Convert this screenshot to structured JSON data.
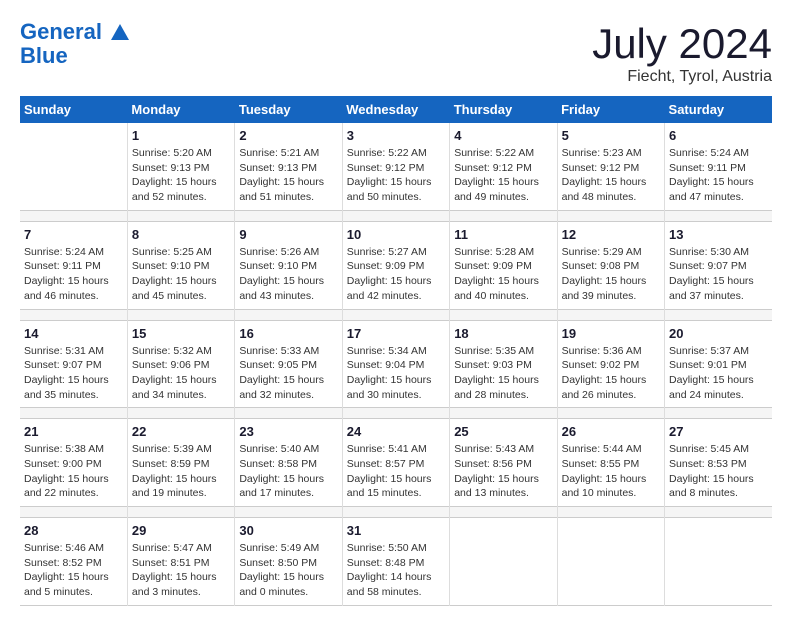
{
  "header": {
    "logo_line1": "General",
    "logo_line2": "Blue",
    "month_year": "July 2024",
    "location": "Fiecht, Tyrol, Austria"
  },
  "weekdays": [
    "Sunday",
    "Monday",
    "Tuesday",
    "Wednesday",
    "Thursday",
    "Friday",
    "Saturday"
  ],
  "weeks": [
    [
      {
        "day": "",
        "info": ""
      },
      {
        "day": "1",
        "info": "Sunrise: 5:20 AM\nSunset: 9:13 PM\nDaylight: 15 hours\nand 52 minutes."
      },
      {
        "day": "2",
        "info": "Sunrise: 5:21 AM\nSunset: 9:13 PM\nDaylight: 15 hours\nand 51 minutes."
      },
      {
        "day": "3",
        "info": "Sunrise: 5:22 AM\nSunset: 9:12 PM\nDaylight: 15 hours\nand 50 minutes."
      },
      {
        "day": "4",
        "info": "Sunrise: 5:22 AM\nSunset: 9:12 PM\nDaylight: 15 hours\nand 49 minutes."
      },
      {
        "day": "5",
        "info": "Sunrise: 5:23 AM\nSunset: 9:12 PM\nDaylight: 15 hours\nand 48 minutes."
      },
      {
        "day": "6",
        "info": "Sunrise: 5:24 AM\nSunset: 9:11 PM\nDaylight: 15 hours\nand 47 minutes."
      }
    ],
    [
      {
        "day": "7",
        "info": "Sunrise: 5:24 AM\nSunset: 9:11 PM\nDaylight: 15 hours\nand 46 minutes."
      },
      {
        "day": "8",
        "info": "Sunrise: 5:25 AM\nSunset: 9:10 PM\nDaylight: 15 hours\nand 45 minutes."
      },
      {
        "day": "9",
        "info": "Sunrise: 5:26 AM\nSunset: 9:10 PM\nDaylight: 15 hours\nand 43 minutes."
      },
      {
        "day": "10",
        "info": "Sunrise: 5:27 AM\nSunset: 9:09 PM\nDaylight: 15 hours\nand 42 minutes."
      },
      {
        "day": "11",
        "info": "Sunrise: 5:28 AM\nSunset: 9:09 PM\nDaylight: 15 hours\nand 40 minutes."
      },
      {
        "day": "12",
        "info": "Sunrise: 5:29 AM\nSunset: 9:08 PM\nDaylight: 15 hours\nand 39 minutes."
      },
      {
        "day": "13",
        "info": "Sunrise: 5:30 AM\nSunset: 9:07 PM\nDaylight: 15 hours\nand 37 minutes."
      }
    ],
    [
      {
        "day": "14",
        "info": "Sunrise: 5:31 AM\nSunset: 9:07 PM\nDaylight: 15 hours\nand 35 minutes."
      },
      {
        "day": "15",
        "info": "Sunrise: 5:32 AM\nSunset: 9:06 PM\nDaylight: 15 hours\nand 34 minutes."
      },
      {
        "day": "16",
        "info": "Sunrise: 5:33 AM\nSunset: 9:05 PM\nDaylight: 15 hours\nand 32 minutes."
      },
      {
        "day": "17",
        "info": "Sunrise: 5:34 AM\nSunset: 9:04 PM\nDaylight: 15 hours\nand 30 minutes."
      },
      {
        "day": "18",
        "info": "Sunrise: 5:35 AM\nSunset: 9:03 PM\nDaylight: 15 hours\nand 28 minutes."
      },
      {
        "day": "19",
        "info": "Sunrise: 5:36 AM\nSunset: 9:02 PM\nDaylight: 15 hours\nand 26 minutes."
      },
      {
        "day": "20",
        "info": "Sunrise: 5:37 AM\nSunset: 9:01 PM\nDaylight: 15 hours\nand 24 minutes."
      }
    ],
    [
      {
        "day": "21",
        "info": "Sunrise: 5:38 AM\nSunset: 9:00 PM\nDaylight: 15 hours\nand 22 minutes."
      },
      {
        "day": "22",
        "info": "Sunrise: 5:39 AM\nSunset: 8:59 PM\nDaylight: 15 hours\nand 19 minutes."
      },
      {
        "day": "23",
        "info": "Sunrise: 5:40 AM\nSunset: 8:58 PM\nDaylight: 15 hours\nand 17 minutes."
      },
      {
        "day": "24",
        "info": "Sunrise: 5:41 AM\nSunset: 8:57 PM\nDaylight: 15 hours\nand 15 minutes."
      },
      {
        "day": "25",
        "info": "Sunrise: 5:43 AM\nSunset: 8:56 PM\nDaylight: 15 hours\nand 13 minutes."
      },
      {
        "day": "26",
        "info": "Sunrise: 5:44 AM\nSunset: 8:55 PM\nDaylight: 15 hours\nand 10 minutes."
      },
      {
        "day": "27",
        "info": "Sunrise: 5:45 AM\nSunset: 8:53 PM\nDaylight: 15 hours\nand 8 minutes."
      }
    ],
    [
      {
        "day": "28",
        "info": "Sunrise: 5:46 AM\nSunset: 8:52 PM\nDaylight: 15 hours\nand 5 minutes."
      },
      {
        "day": "29",
        "info": "Sunrise: 5:47 AM\nSunset: 8:51 PM\nDaylight: 15 hours\nand 3 minutes."
      },
      {
        "day": "30",
        "info": "Sunrise: 5:49 AM\nSunset: 8:50 PM\nDaylight: 15 hours\nand 0 minutes."
      },
      {
        "day": "31",
        "info": "Sunrise: 5:50 AM\nSunset: 8:48 PM\nDaylight: 14 hours\nand 58 minutes."
      },
      {
        "day": "",
        "info": ""
      },
      {
        "day": "",
        "info": ""
      },
      {
        "day": "",
        "info": ""
      }
    ]
  ]
}
